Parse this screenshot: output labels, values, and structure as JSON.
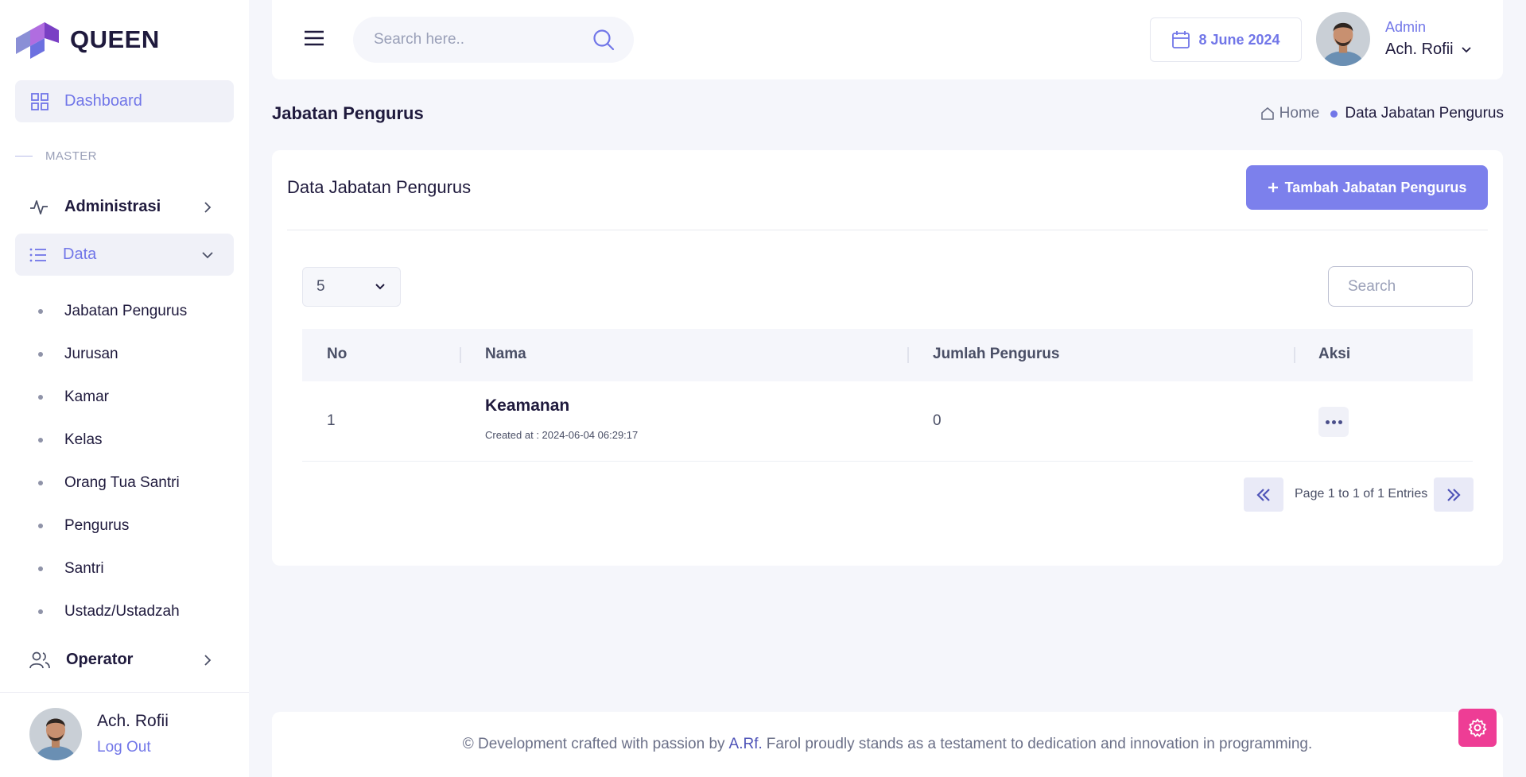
{
  "brand": {
    "name": "QUEEN"
  },
  "sidebar": {
    "dashboard_label": "Dashboard",
    "section_master": "MASTER",
    "administrasi_label": "Administrasi",
    "data_label": "Data",
    "data_items": [
      "Jabatan Pengurus",
      "Jurusan",
      "Kamar",
      "Kelas",
      "Orang Tua Santri",
      "Pengurus",
      "Santri",
      "Ustadz/Ustadzah"
    ],
    "operator_label": "Operator",
    "user": {
      "name": "Ach. Rofii",
      "logout": "Log Out"
    }
  },
  "header": {
    "search_placeholder": "Search here..",
    "date": "8 June 2024",
    "user_role": "Admin",
    "user_name": "Ach. Rofii"
  },
  "page": {
    "title": "Jabatan Pengurus",
    "breadcrumb": {
      "home": "Home",
      "current": "Data Jabatan Pengurus"
    }
  },
  "card": {
    "title": "Data Jabatan Pengurus",
    "add_button": "Tambah Jabatan Pengurus",
    "per_page": "5",
    "search_placeholder": "Search",
    "columns": [
      "No",
      "Nama",
      "Jumlah Pengurus",
      "Aksi"
    ],
    "rows": [
      {
        "no": "1",
        "nama": "Keamanan",
        "created": "Created at : 2024-06-04 06:29:17",
        "jumlah": "0"
      }
    ],
    "pagination": "Page 1 to 1 of 1 Entries"
  },
  "footer": {
    "prefix": "© Development crafted with passion by",
    "brand": "A.Rf.",
    "suffix": "Farol proudly stands as a testament to dedication and innovation in programming."
  },
  "colors": {
    "accent": "#7176e8",
    "button": "#7c80ec",
    "settings": "#ee3d95"
  }
}
